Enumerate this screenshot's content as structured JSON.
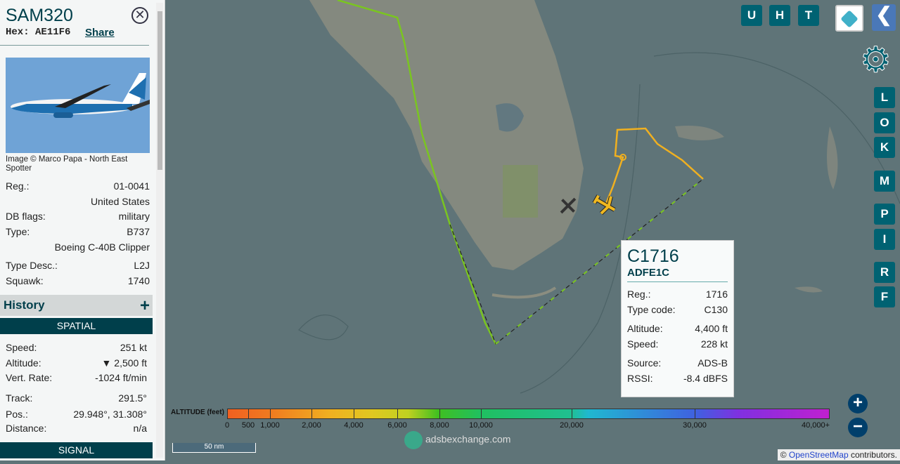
{
  "aircraft": {
    "callsign": "SAM320",
    "hex_label": "Hex:",
    "hex": "AE11F6",
    "share": "Share",
    "image_credit": "Image © Marco Papa - North East Spotter",
    "details": [
      {
        "label": "Reg.:",
        "value": "01-0041"
      },
      {
        "label": "",
        "value": "United States"
      },
      {
        "label": "DB flags:",
        "value": "military"
      },
      {
        "label": "Type:",
        "value": "B737"
      },
      {
        "label": "",
        "value": "Boeing C-40B Clipper"
      },
      {
        "label": "Type Desc.:",
        "value": "L2J"
      },
      {
        "label": "Squawk:",
        "value": "1740"
      }
    ],
    "history_label": "History",
    "spatial_label": "SPATIAL",
    "spatial": [
      {
        "label": "Speed:",
        "value": "251 kt"
      },
      {
        "label": "Altitude:",
        "value": "▼ 2,500 ft"
      },
      {
        "label": "Vert. Rate:",
        "value": "-1024 ft/min"
      },
      {
        "label": "Track:",
        "value": "291.5°"
      },
      {
        "label": "Pos.:",
        "value": "29.948°, 31.308°"
      },
      {
        "label": "Distance:",
        "value": "n/a"
      }
    ],
    "signal_label": "SIGNAL"
  },
  "popup": {
    "callsign": "C1716",
    "hex": "ADFE1C",
    "rows": [
      {
        "label": "Reg.:",
        "value": "1716"
      },
      {
        "label": "Type code:",
        "value": "C130"
      },
      {
        "label": "Altitude:",
        "value": "4,400 ft"
      },
      {
        "label": "Speed:",
        "value": "228 kt"
      },
      {
        "label": "Source:",
        "value": "ADS-B"
      },
      {
        "label": "RSSI:",
        "value": "-8.4 dBFS"
      }
    ]
  },
  "top_buttons": [
    "U",
    "H",
    "T"
  ],
  "side_buttons": [
    "L",
    "O",
    "K",
    "M",
    "P",
    "I",
    "R",
    "F"
  ],
  "legend": {
    "title": "ALTITUDE (feet)",
    "ticks": [
      "0",
      "500",
      "1,000",
      "2,000",
      "4,000",
      "6,000",
      "8,000",
      "10,000",
      "20,000",
      "30,000",
      "40,000+"
    ]
  },
  "scale_label": "50 nm",
  "watermark": "adsbexchange.com",
  "attribution": {
    "prefix": "© ",
    "link": "OpenStreetMap",
    "suffix": " contributors."
  },
  "zoom": {
    "in": "+",
    "out": "−"
  },
  "colors": {
    "accent": "#003f4b",
    "button": "#006272",
    "track_low": "#7ac520",
    "track_selected": "#f0b020"
  }
}
